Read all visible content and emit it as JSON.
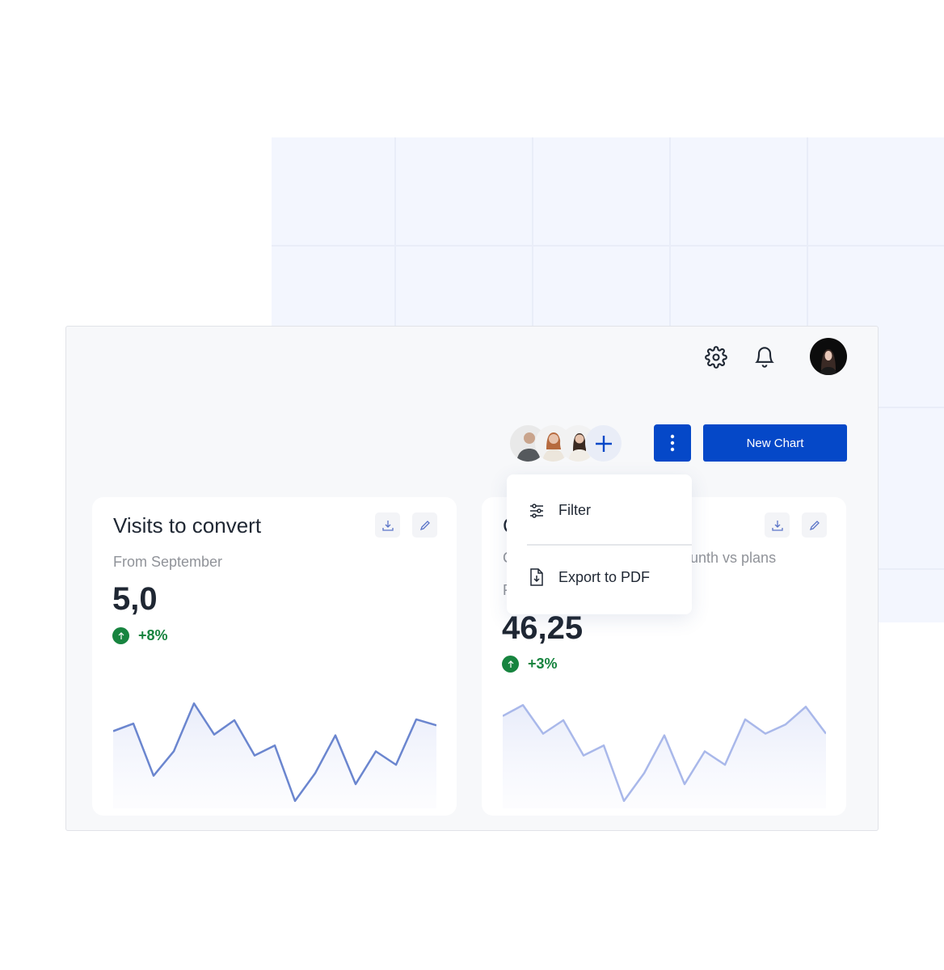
{
  "header": {
    "icons": [
      "gear-icon",
      "bell-icon",
      "user-avatar"
    ]
  },
  "toolbar": {
    "collaborators": [
      "avatar-man",
      "avatar-woman-1",
      "avatar-woman-2"
    ],
    "add_icon": "plus-icon",
    "more_icon": "vertical-dots-icon",
    "new_chart_label": "New Chart"
  },
  "menu": {
    "items": [
      {
        "label": "Filter",
        "icon": "sliders-icon"
      },
      {
        "label": "Export to PDF",
        "icon": "file-download-icon"
      }
    ]
  },
  "cards": [
    {
      "title": "Visits to convert",
      "subtitle": "From September",
      "value": "5,0",
      "delta": "+8%"
    },
    {
      "title_visible": "C",
      "subtitle_visible": "unth vs plans",
      "subtitle_start": "C",
      "label_start": "F",
      "value": "46,25",
      "delta": "+3%"
    }
  ],
  "colors": {
    "accent": "#0548c8",
    "positive": "#17843f",
    "line_left": "#6b86cf",
    "line_right": "#a9b8ea"
  },
  "chart_data": [
    {
      "type": "area",
      "x": [
        0,
        1,
        2,
        3,
        4,
        5,
        6,
        7,
        8,
        9,
        10,
        11,
        12,
        13,
        14,
        15,
        16
      ],
      "values": [
        87,
        96,
        34,
        63,
        120,
        83,
        100,
        58,
        70,
        4,
        37,
        82,
        24,
        63,
        47,
        101,
        94
      ]
    },
    {
      "type": "area",
      "x": [
        0,
        1,
        2,
        3,
        4,
        5,
        6,
        7,
        8,
        9,
        10,
        11,
        12,
        13,
        14,
        15,
        16
      ],
      "values": [
        105,
        118,
        84,
        100,
        58,
        70,
        4,
        37,
        82,
        24,
        63,
        47,
        101,
        84,
        95,
        116,
        84
      ]
    }
  ]
}
